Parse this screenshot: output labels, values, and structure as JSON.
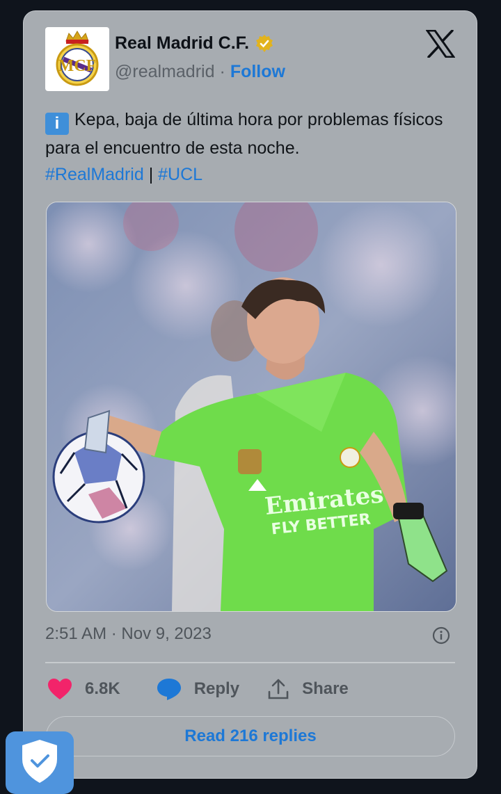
{
  "account": {
    "name": "Real Madrid C.F.",
    "handle": "@realmadrid",
    "dot": "·",
    "follow_label": "Follow",
    "verified_icon": "gold-verified-badge-icon",
    "avatar_icon": "real-madrid-crest-logo"
  },
  "tweet": {
    "info_emoji": "i",
    "text": "Kepa, baja de última hora por problemas físicos para el encuentro de esta noche.",
    "hashtag1": "#RealMadrid",
    "separator": "|",
    "hashtag2": "#UCL"
  },
  "media": {
    "icon": "photo-goalkeeper-green-kit"
  },
  "meta": {
    "timestamp": "2:51 AM · Nov 9, 2023"
  },
  "actions": {
    "likes": "6.8K",
    "reply_label": "Reply",
    "share_label": "Share"
  },
  "read_replies_label": "Read 216 replies",
  "colors": {
    "accent": "#1d78d6",
    "like": "#f2246a",
    "card": "#a7acb1",
    "background": "#0f141c"
  }
}
